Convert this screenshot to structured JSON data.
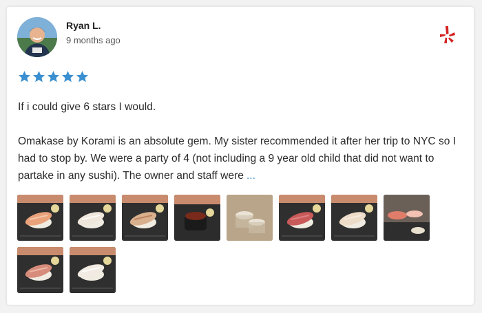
{
  "review": {
    "author": "Ryan L.",
    "time_ago": "9 months ago",
    "rating": 5,
    "rating_max": 5,
    "star_color": "#3a8fd0",
    "source_icon": "yelp-icon",
    "source_color": "#d32323",
    "paragraph1": "If i could give 6 stars I would.",
    "paragraph2": "Omakase by Korami is an absolute gem. My sister recommended it after her trip to NYC so I had to stop by. We were a party of 4 (not including a 9 year old child that did not want to partake in any sushi). The owner and staff were",
    "more_label": "..."
  },
  "photos": [
    {
      "subject": "nigiri-salmon"
    },
    {
      "subject": "nigiri-white-fish"
    },
    {
      "subject": "nigiri-seared"
    },
    {
      "subject": "gunkan-roe"
    },
    {
      "subject": "sake-glasses"
    },
    {
      "subject": "nigiri-tuna"
    },
    {
      "subject": "nigiri-yellowtail"
    },
    {
      "subject": "plated-sushi"
    },
    {
      "subject": "nigiri-fatty-tuna"
    },
    {
      "subject": "nigiri-scallop"
    }
  ]
}
